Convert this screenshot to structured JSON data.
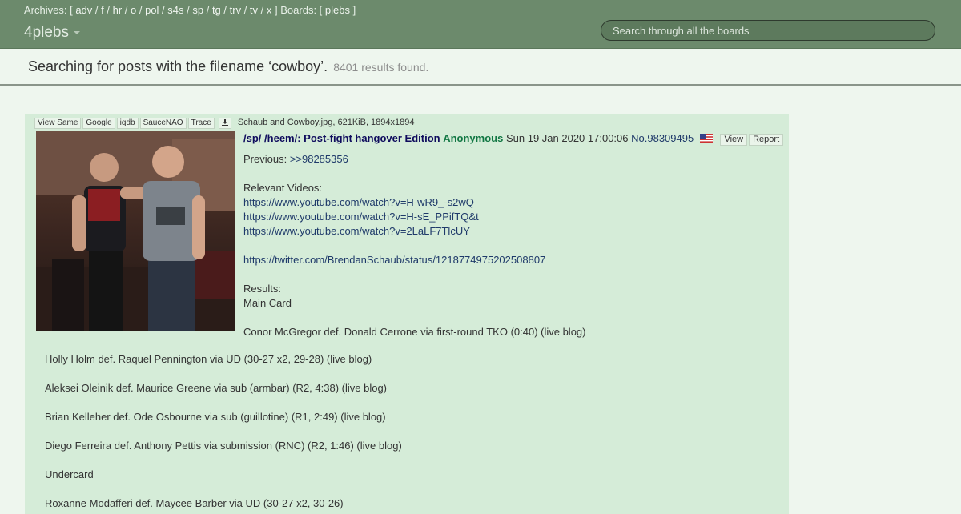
{
  "topbar": {
    "archives_label": "Archives: [",
    "archives": [
      "adv",
      "f",
      "hr",
      "o",
      "pol",
      "s4s",
      "sp",
      "tg",
      "trv",
      "tv",
      "x"
    ],
    "archives_close": "]",
    "boards_label": "Boards: [",
    "boards": [
      "plebs"
    ],
    "boards_close": "]",
    "brand": "4plebs",
    "search_placeholder": "Search through all the boards"
  },
  "heading": {
    "title": "Searching for posts with the filename ‘cowboy’.",
    "count": "8401 results found."
  },
  "post": {
    "file_buttons": [
      "View Same",
      "Google",
      "iqdb",
      "SauceNAO",
      "Trace"
    ],
    "download_icon": "download-icon",
    "file_info": "Schaub and Cowboy.jpg, 621KiB, 1894x1894",
    "board": "/sp/",
    "subject": "/heem/: Post-fight hangover Edition",
    "author": "Anonymous",
    "date": "Sun 19 Jan 2020 17:00:06",
    "number": "No.98309495",
    "flag_icon": "us-flag-icon",
    "view_label": "View",
    "report_label": "Report",
    "body_top": [
      {
        "text": "Previous: ",
        "link": ">>98285356"
      },
      {
        "text": ""
      },
      {
        "text": "Relevant Videos:"
      },
      {
        "text": "",
        "link": "https://www.youtube.com/watch?v=H-wR9_-s2wQ"
      },
      {
        "text": "",
        "link": "https://www.youtube.com/watch?v=H-sE_PPifTQ&t"
      },
      {
        "text": "",
        "link": "https://www.youtube.com/watch?v=2LaLF7TlcUY"
      },
      {
        "text": ""
      },
      {
        "text": "",
        "link": "https://twitter.com/BrendanSchaub/status/1218774975202508807"
      },
      {
        "text": ""
      },
      {
        "text": "Results:"
      },
      {
        "text": "Main Card"
      },
      {
        "text": ""
      },
      {
        "text": "Conor McGregor def. Donald Cerrone via first-round TKO (0:40) (live blog)"
      }
    ],
    "body_bottom": [
      "Holly Holm def. Raquel Pennington via UD (30-27 x2, 29-28) (live blog)",
      "",
      "Aleksei Oleinik def. Maurice Greene via sub (armbar) (R2, 4:38) (live blog)",
      "",
      "Brian Kelleher def. Ode Osbourne via sub (guillotine) (R1, 2:49) (live blog)",
      "",
      "Diego Ferreira def. Anthony Pettis via submission (RNC) (R2, 1:46) (live blog)",
      "",
      "Undercard",
      "",
      "Roxanne Modafferi def. Maycee Barber via UD (30-27 x2, 30-26)"
    ]
  }
}
